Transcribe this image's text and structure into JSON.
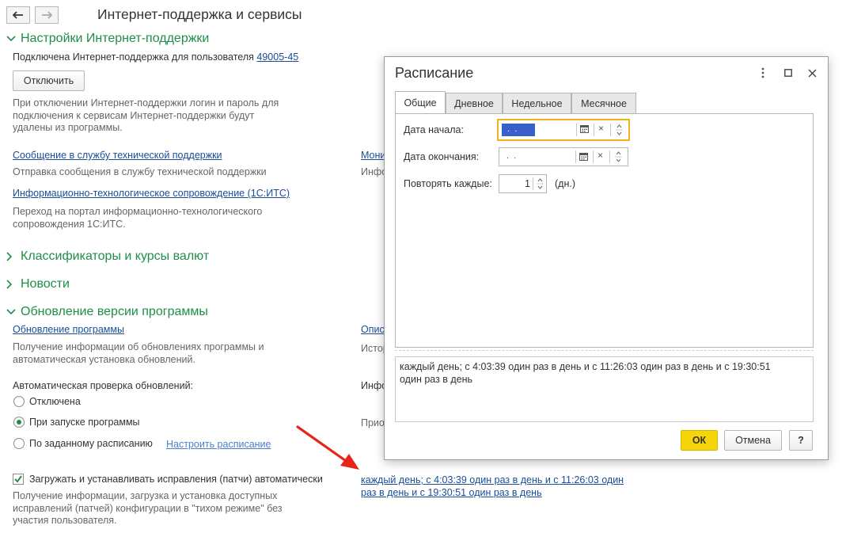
{
  "page": {
    "title": "Интернет-поддержка и сервисы"
  },
  "sections": {
    "support_settings": {
      "title": "Настройки Интернет-поддержки",
      "connected_label": "Подключена Интернет-поддержка для пользователя",
      "user_link": "49005-45",
      "disconnect_button": "Отключить",
      "disconnect_note": [
        "При отключении Интернет-поддержки логин и пароль для",
        "подключения к сервисам Интернет-поддержки будут",
        "удалены из программы."
      ],
      "message_link": "Сообщение в службу технической поддержки",
      "message_desc": "Отправка сообщения в службу технической поддержки",
      "its_link": "Информационно-технологическое сопровождение (1С:ИТС)",
      "its_desc": [
        "Переход на портал информационно-технологического",
        "сопровождения 1С:ИТС."
      ],
      "right_link_partial": "Мони",
      "right_desc_partial": "Инфо"
    },
    "classifiers": {
      "title": "Классификаторы и курсы валют"
    },
    "news": {
      "title": "Новости"
    },
    "update": {
      "title": "Обновление версии программы",
      "update_link": "Обновление программы",
      "update_desc": [
        "Получение информации об обновлениях программы и",
        "автоматическая установка обновлений."
      ],
      "auto_check_label": "Автоматическая проверка обновлений:",
      "options": [
        "Отключена",
        "При запуске программы",
        "По заданному расписанию"
      ],
      "selected_option": 1,
      "configure_link": "Настроить расписание",
      "patch_checkbox_label": "Загружать и устанавливать исправления (патчи) автоматически",
      "patch_checked": true,
      "patch_desc": [
        "Получение информации, загрузка и установка доступных",
        "исправлений (патчей) конфигурации в \"тихом режиме\" без",
        "участия пользователя."
      ],
      "right_link_partial": "Опис",
      "right_desc_partial": "Истор",
      "right_label_partial": "Инфо",
      "right_label2_partial": "Прио",
      "schedule_link": [
        "каждый день; с 4:03:39 один раз в день и с 11:26:03 один",
        "раз в день и с 19:30:51 один раз в день"
      ]
    }
  },
  "dialog": {
    "title": "Расписание",
    "tabs": [
      "Общие",
      "Дневное",
      "Недельное",
      "Месячное"
    ],
    "active_tab": 0,
    "start_date_label": "Дата начала:",
    "start_date_value": " .  .",
    "end_date_label": "Дата окончания:",
    "end_date_value": " .  .",
    "repeat_label": "Повторять каждые:",
    "repeat_value": "1",
    "repeat_unit": "(дн.)",
    "description": "каждый день; с 4:03:39 один раз в день и с 11:26:03 один раз в день и с 19:30:51\nодин раз в день",
    "ok_button": "ОК",
    "cancel_button": "Отмена",
    "help_button": "?"
  },
  "colors": {
    "section_green": "#1e8e4a",
    "link_blue": "#1a4d99",
    "ok_yellow": "#f5d50a",
    "focus_orange": "#f0b21a",
    "arrow_red": "#e8231a"
  }
}
